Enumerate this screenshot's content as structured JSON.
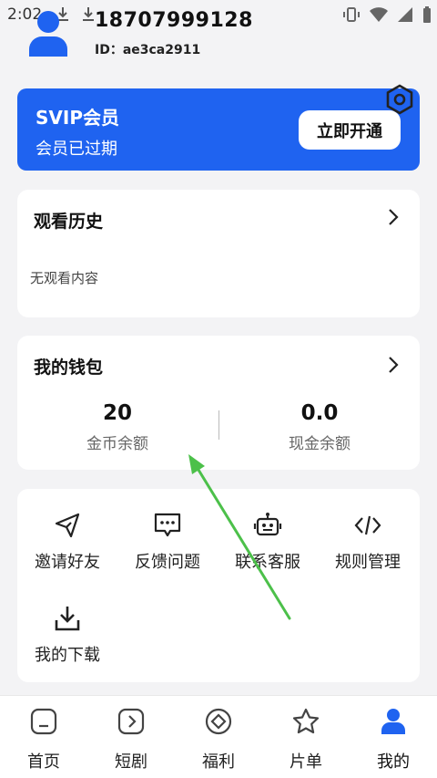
{
  "status_bar": {
    "time": "2:02"
  },
  "profile": {
    "phone": "18707999128",
    "id_text": "ID：ae3ca2911"
  },
  "vip": {
    "title": "SVIP会员",
    "subtitle": "会员已过期",
    "button_label": "立即开通"
  },
  "history": {
    "title": "观看历史",
    "empty_text": "无观看内容"
  },
  "wallet": {
    "title": "我的钱包",
    "coins": {
      "value": "20",
      "label": "金币余额"
    },
    "cash": {
      "value": "0.0",
      "label": "现金余额"
    }
  },
  "tools": [
    {
      "label": "邀请好友",
      "icon": "send-icon"
    },
    {
      "label": "反馈问题",
      "icon": "feedback-icon"
    },
    {
      "label": "联系客服",
      "icon": "robot-icon"
    },
    {
      "label": "规则管理",
      "icon": "code-icon"
    },
    {
      "label": "我的下载",
      "icon": "download-icon"
    }
  ],
  "nav": [
    {
      "label": "首页",
      "icon": "home-icon"
    },
    {
      "label": "短剧",
      "icon": "play-icon"
    },
    {
      "label": "福利",
      "icon": "gift-icon"
    },
    {
      "label": "片单",
      "icon": "star-icon"
    },
    {
      "label": "我的",
      "icon": "user-icon",
      "active": true
    }
  ],
  "colors": {
    "accent": "#1f63f0",
    "annotation_arrow": "#4cc04a"
  }
}
